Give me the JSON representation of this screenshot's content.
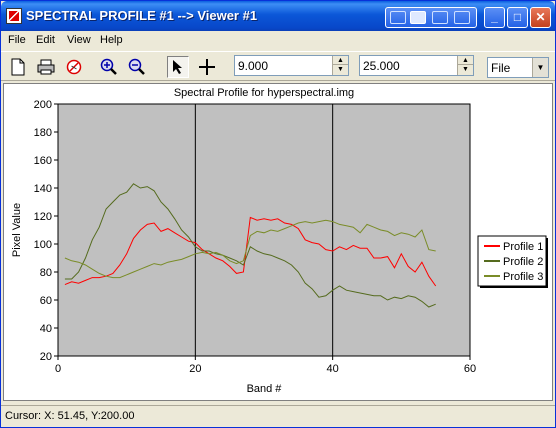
{
  "window": {
    "title": "SPECTRAL PROFILE #1 --> Viewer #1"
  },
  "menu": [
    "File",
    "Edit",
    "View",
    "Help"
  ],
  "toolbar": {
    "value1": "9.000",
    "value2": "25.000",
    "mode_select": "File",
    "icons": [
      "new-icon",
      "print-icon",
      "clear-icon",
      "zoom-in-icon",
      "zoom-out-icon",
      "select-arrow-icon",
      "crosshair-icon"
    ]
  },
  "status": {
    "cursor_text": "Cursor: X: 51.45, Y:200.00"
  },
  "chart_data": {
    "type": "line",
    "title": "Spectral Profile for hyperspectral.img",
    "xlabel": "Band #",
    "ylabel": "Pixel Value",
    "xlim": [
      0,
      60
    ],
    "ylim": [
      20,
      200
    ],
    "xticks": [
      0,
      20,
      40,
      60
    ],
    "yticks": [
      20,
      40,
      60,
      80,
      100,
      120,
      140,
      160,
      180,
      200
    ],
    "grid": "vertical major lines at x=20, 40",
    "legend_position": "right",
    "background": "#c0c0c0",
    "series": [
      {
        "name": "Profile 1",
        "color": "#ff0000",
        "x": [
          1,
          2,
          3,
          4,
          5,
          6,
          7,
          8,
          9,
          10,
          11,
          12,
          13,
          14,
          15,
          16,
          17,
          18,
          19,
          20,
          21,
          22,
          23,
          24,
          25,
          26,
          27,
          28,
          29,
          30,
          31,
          32,
          33,
          34,
          35,
          36,
          37,
          38,
          39,
          40,
          41,
          42,
          43,
          44,
          45,
          46,
          47,
          48,
          49,
          50,
          51,
          52,
          53,
          54,
          55
        ],
        "values": [
          71,
          73,
          72,
          74,
          76,
          76,
          77,
          79,
          85,
          93,
          104,
          110,
          114,
          115,
          109,
          111,
          108,
          105,
          102,
          101,
          96,
          93,
          90,
          88,
          84,
          79,
          80,
          119,
          117,
          118,
          117,
          118,
          115,
          114,
          111,
          103,
          101,
          100,
          96,
          95,
          98,
          96,
          99,
          97,
          97,
          90,
          90,
          91,
          83,
          93,
          84,
          80,
          87,
          77,
          70
        ]
      },
      {
        "name": "Profile 2",
        "color": "#556b1e",
        "x": [
          1,
          2,
          3,
          4,
          5,
          6,
          7,
          8,
          9,
          10,
          11,
          12,
          13,
          14,
          15,
          16,
          17,
          18,
          19,
          20,
          21,
          22,
          23,
          24,
          25,
          26,
          27,
          28,
          29,
          30,
          31,
          32,
          33,
          34,
          35,
          36,
          37,
          38,
          39,
          40,
          41,
          42,
          43,
          44,
          45,
          46,
          47,
          48,
          49,
          50,
          51,
          52,
          53,
          54,
          55
        ],
        "values": [
          75,
          75,
          80,
          90,
          103,
          112,
          125,
          130,
          135,
          137,
          143,
          140,
          141,
          138,
          130,
          125,
          118,
          110,
          105,
          98,
          95,
          95,
          93,
          92,
          90,
          88,
          85,
          98,
          95,
          93,
          92,
          90,
          88,
          85,
          80,
          72,
          68,
          62,
          63,
          67,
          70,
          67,
          66,
          65,
          64,
          63,
          63,
          60,
          62,
          61,
          63,
          62,
          59,
          55,
          57
        ]
      },
      {
        "name": "Profile 3",
        "color": "#7a8c28",
        "x": [
          1,
          2,
          3,
          4,
          5,
          6,
          7,
          8,
          9,
          10,
          11,
          12,
          13,
          14,
          15,
          16,
          17,
          18,
          19,
          20,
          21,
          22,
          23,
          24,
          25,
          26,
          27,
          28,
          29,
          30,
          31,
          32,
          33,
          34,
          35,
          36,
          37,
          38,
          39,
          40,
          41,
          42,
          43,
          44,
          45,
          46,
          47,
          48,
          49,
          50,
          51,
          52,
          53,
          54,
          55
        ],
        "values": [
          90,
          88,
          87,
          85,
          82,
          79,
          77,
          76,
          76,
          78,
          80,
          82,
          84,
          86,
          85,
          87,
          88,
          89,
          91,
          93,
          94,
          93,
          94,
          92,
          88,
          86,
          88,
          106,
          109,
          108,
          110,
          109,
          111,
          113,
          115,
          116,
          115,
          116,
          117,
          116,
          114,
          113,
          112,
          108,
          114,
          112,
          110,
          109,
          106,
          108,
          107,
          105,
          110,
          96,
          95
        ]
      }
    ]
  }
}
